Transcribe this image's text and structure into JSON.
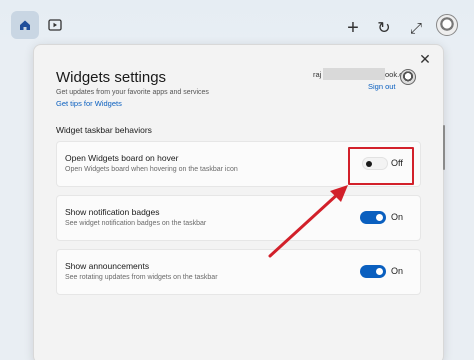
{
  "topbar": {
    "home_icon": "home-icon",
    "video_icon": "video-icon",
    "plus_icon": "plus-icon",
    "refresh_icon": "refresh-icon",
    "expand_icon": "expand-icon"
  },
  "dialog": {
    "title": "Widgets settings",
    "subtitle": "Get updates from your favorite apps and services",
    "tips_link": "Get tips for Widgets",
    "account": {
      "email_prefix": "raj",
      "email_suffix": "look.com",
      "sign_out": "Sign out"
    },
    "section_label": "Widget taskbar behaviors",
    "settings": [
      {
        "title": "Open Widgets board on hover",
        "description": "Open Widgets board when hovering on the taskbar icon",
        "state": "Off",
        "enabled": false
      },
      {
        "title": "Show notification badges",
        "description": "See widget notification badges on the taskbar",
        "state": "On",
        "enabled": true
      },
      {
        "title": "Show announcements",
        "description": "See rotating updates from widgets on the taskbar",
        "state": "On",
        "enabled": true
      }
    ]
  },
  "colors": {
    "accent": "#0a5fbf",
    "highlight": "#d2202a"
  }
}
